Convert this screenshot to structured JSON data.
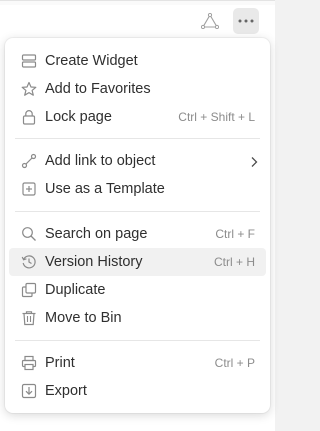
{
  "toolbar": {
    "graph_icon": "graph-icon",
    "more_icon": "more-horizontal-icon"
  },
  "menu": {
    "groups": [
      [
        {
          "label": "Create Widget",
          "icon": "widget-icon"
        },
        {
          "label": "Add to Favorites",
          "icon": "star-icon"
        },
        {
          "label": "Lock page",
          "icon": "lock-icon",
          "shortcut": "Ctrl + Shift + L"
        }
      ],
      [
        {
          "label": "Add link to object",
          "icon": "link-icon",
          "submenu": true
        },
        {
          "label": "Use as a Template",
          "icon": "template-icon"
        }
      ],
      [
        {
          "label": "Search on page",
          "icon": "search-icon",
          "shortcut": "Ctrl + F"
        },
        {
          "label": "Version History",
          "icon": "history-icon",
          "shortcut": "Ctrl + H",
          "highlighted": true
        },
        {
          "label": "Duplicate",
          "icon": "duplicate-icon"
        },
        {
          "label": "Move to Bin",
          "icon": "trash-icon"
        }
      ],
      [
        {
          "label": "Print",
          "icon": "print-icon",
          "shortcut": "Ctrl + P"
        },
        {
          "label": "Export",
          "icon": "export-icon"
        }
      ]
    ]
  },
  "colors": {
    "highlight": "#f1f1f1",
    "text": "#2f2f2f",
    "shortcut": "#8c8c8c",
    "icon": "#8a8a8a"
  }
}
